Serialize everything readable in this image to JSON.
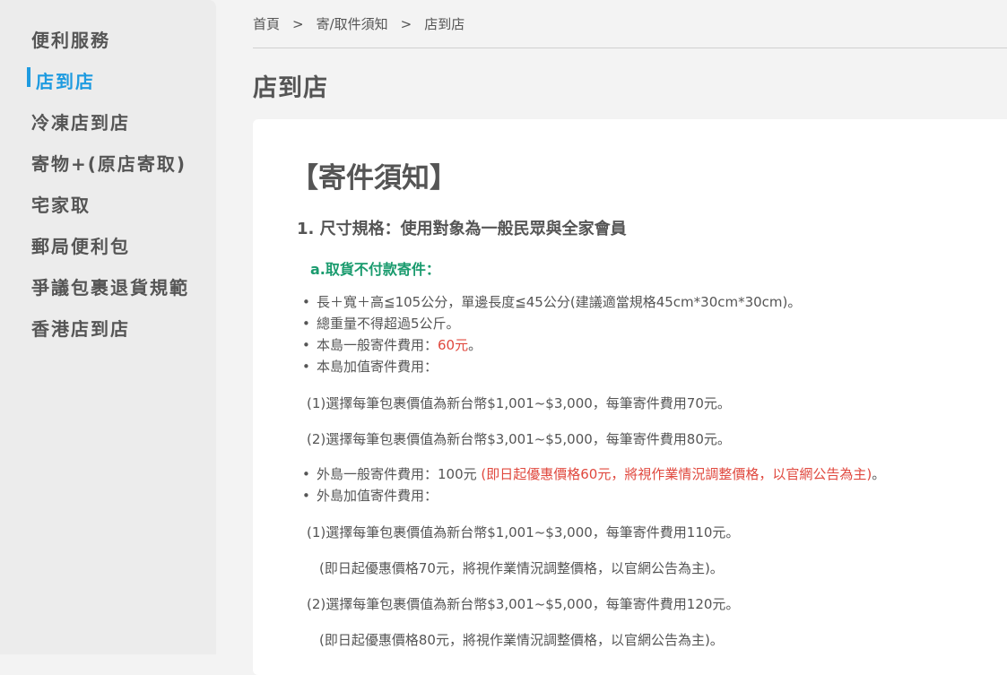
{
  "sidebar": {
    "items": [
      {
        "label": "便利服務"
      },
      {
        "label": "店到店"
      },
      {
        "label": "冷凍店到店"
      },
      {
        "label": "寄物+(原店寄取)"
      },
      {
        "label": "宅家取"
      },
      {
        "label": "郵局便利包"
      },
      {
        "label": "爭議包裹退貨規範"
      },
      {
        "label": "香港店到店"
      }
    ],
    "active_index": 1
  },
  "breadcrumb": {
    "home": "首頁",
    "sep": ">",
    "level1": "寄/取件須知",
    "current": "店到店"
  },
  "page_title": "店到店",
  "content": {
    "notice_title": "【寄件須知】",
    "section1_title": "1. 尺寸規格：使用對象為一般民眾與全家會員",
    "sub_a_title": "a.取貨不付款寄件：",
    "bullets1": {
      "b1": "長＋寬＋高≦105公分，單邊長度≦45公分(建議適當規格45cm*30cm*30cm)。",
      "b2": "總重量不得超過5公斤。",
      "b3_label": "本島一般寄件費用：",
      "b3_value": "60元",
      "b3_end": "。",
      "b4": "本島加值寄件費用："
    },
    "main_island_value_added": [
      "(1)選擇每筆包裹價值為新台幣$1,001~$3,000，每筆寄件費用70元。",
      "(2)選擇每筆包裹價值為新台幣$3,001~$5,000，每筆寄件費用80元。"
    ],
    "bullets2": {
      "b1_label": "外島一般寄件費用：100元 ",
      "b1_note": "(即日起優惠價格60元，將視作業情況調整價格，以官網公告為主)",
      "b1_end": "。",
      "b2": "外島加值寄件費用："
    },
    "outer_island_value_added": {
      "l1": "(1)選擇每筆包裹價值為新台幣$1,001~$3,000，每筆寄件費用110元。",
      "l1_note": "(即日起優惠價格70元，將視作業情況調整價格，以官網公告為主)。",
      "l2": "(2)選擇每筆包裹價值為新台幣$3,001~$5,000，每筆寄件費用120元。",
      "l2_note": "(即日起優惠價格80元，將視作業情況調整價格，以官網公告為主)。"
    }
  },
  "colors": {
    "accent": "#1e9be0",
    "green": "#1a9b6e",
    "red": "#e0483e",
    "text": "#555555"
  }
}
